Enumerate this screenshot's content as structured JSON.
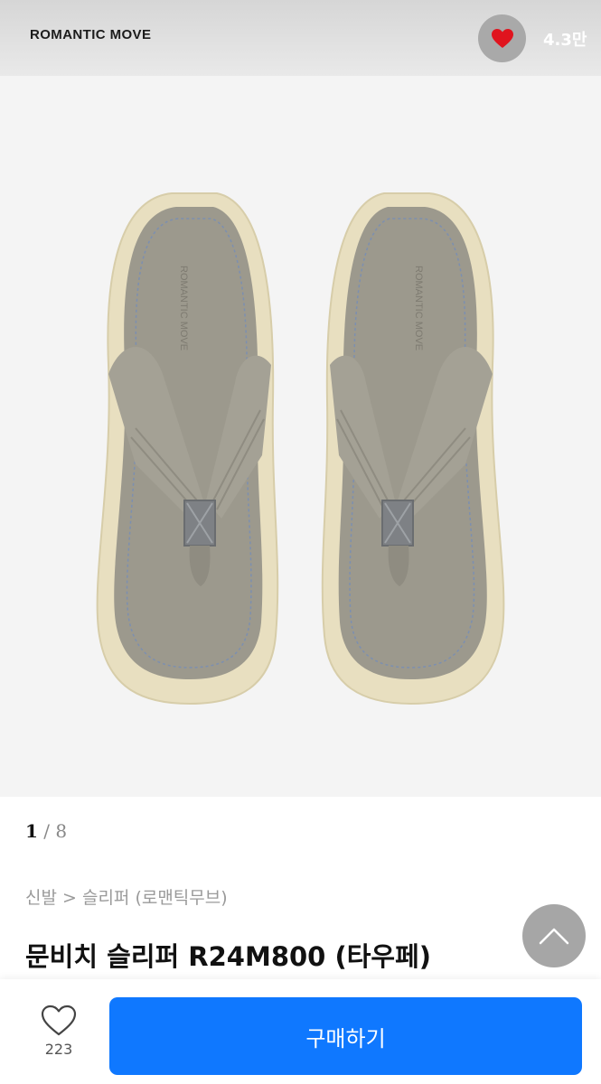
{
  "header": {
    "brand": "ROMANTIC MOVE",
    "like_count": "4.3만"
  },
  "gallery": {
    "current": "1",
    "separator": " / ",
    "total": "8",
    "insole_print": "ROMANTIC MOVE"
  },
  "breadcrumb": "신발 > 슬리퍼 (로맨틱무브)",
  "product": {
    "title": "문비치 슬리퍼 R24M800 (타우페)"
  },
  "bottom_bar": {
    "wish_count": "223",
    "buy_label": "구매하기"
  },
  "colors": {
    "buy_button": "#0f78ff",
    "heart": "#e0141e"
  },
  "icons": {
    "top_heart": "heart-filled-icon",
    "scroll_top": "chevron-up-icon",
    "wish": "heart-outline-icon"
  }
}
